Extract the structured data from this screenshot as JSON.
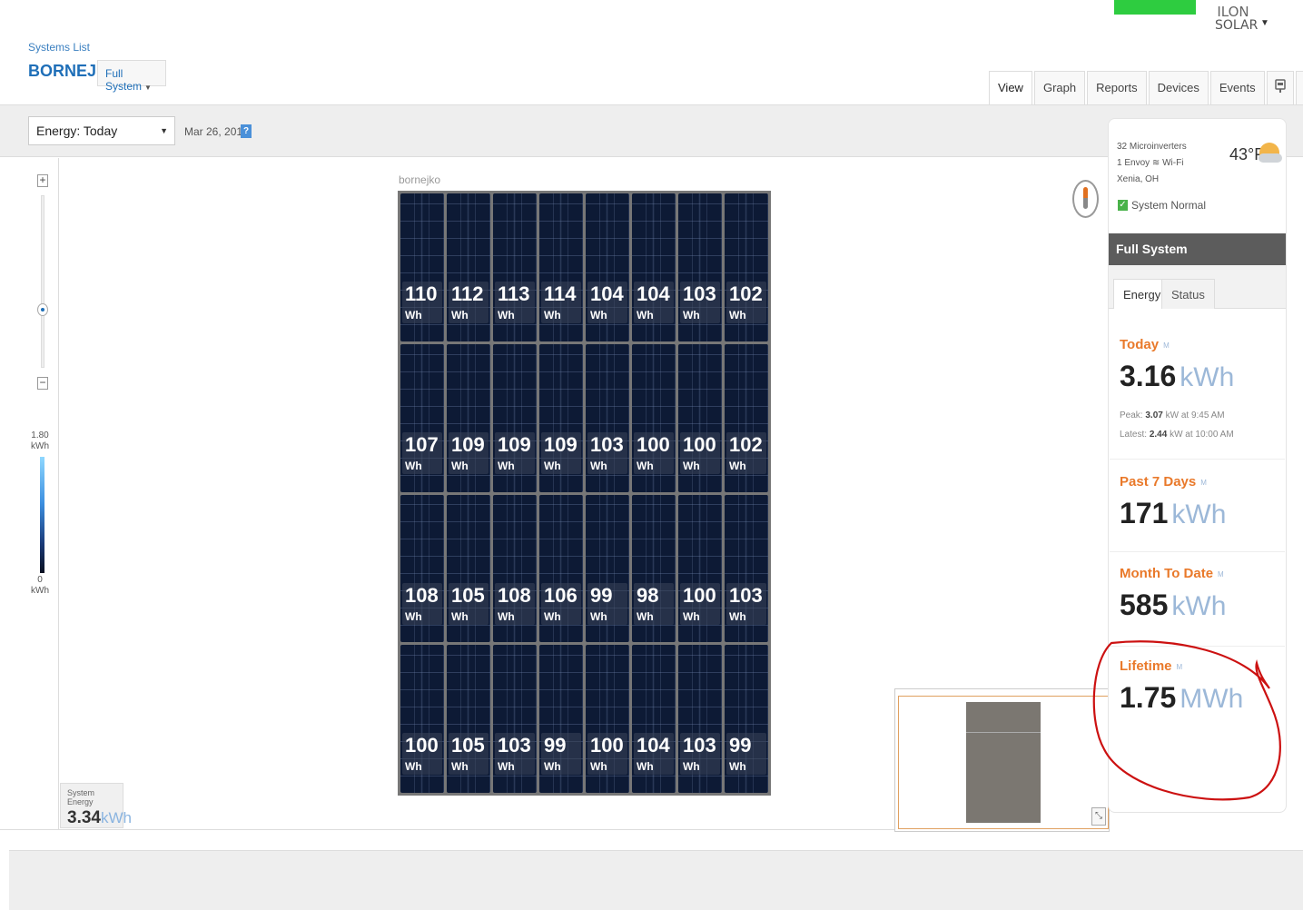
{
  "brand": {
    "logo_line1": "ILON",
    "logo_line2": "SOLAR"
  },
  "breadcrumb": {
    "systems_list": "Systems List"
  },
  "site": {
    "name": "BORNEJKO",
    "view_selector": "Full System"
  },
  "tabs": [
    {
      "label": "View"
    },
    {
      "label": "Graph"
    },
    {
      "label": "Reports"
    },
    {
      "label": "Devices"
    },
    {
      "label": "Events"
    }
  ],
  "toolbar": {
    "energy_select": "Energy: Today",
    "date": "Mar 26, 2018",
    "help": "?"
  },
  "legend": {
    "max_val": "1.80",
    "max_unit": "kWh",
    "min_val": "0",
    "min_unit": "kWh"
  },
  "array": {
    "label": "bornejko",
    "unit": "Wh",
    "rows": [
      [
        "110",
        "112",
        "113",
        "114",
        "104",
        "104",
        "103",
        "102"
      ],
      [
        "107",
        "109",
        "109",
        "109",
        "103",
        "100",
        "100",
        "102"
      ],
      [
        "108",
        "105",
        "108",
        "106",
        "99",
        "98",
        "100",
        "103"
      ],
      [
        "100",
        "105",
        "103",
        "99",
        "100",
        "104",
        "103",
        "99"
      ]
    ]
  },
  "system_energy": {
    "title": "System Energy",
    "value": "3.34",
    "unit": "kWh"
  },
  "side": {
    "microinverters": "32 Microinverters",
    "envoy": "1 Envoy",
    "wifi": "Wi-Fi",
    "location": "Xenia, OH",
    "temperature": "43°F",
    "status": "System Normal",
    "section_title": "Full System",
    "tab_energy": "Energy",
    "tab_status": "Status",
    "today_label": "Today",
    "today_value": "3.16",
    "today_unit": "kWh",
    "peak_prefix": "Peak:",
    "peak_value": "3.07",
    "peak_suffix": "kW at 9:45 AM",
    "latest_prefix": "Latest:",
    "latest_value": "2.44",
    "latest_suffix": "kW at 10:00 AM",
    "week_label": "Past 7 Days",
    "week_value": "171",
    "week_unit": "kWh",
    "month_label": "Month To Date",
    "month_value": "585",
    "month_unit": "kWh",
    "lifetime_label": "Lifetime",
    "lifetime_value": "1.75",
    "lifetime_unit": "MWh",
    "m_badge": "M"
  },
  "colors": {
    "brand_blue": "#1f6fb8",
    "accent_orange": "#e9792a",
    "status_green": "#49b24a",
    "annotation_red": "#cc1111"
  }
}
